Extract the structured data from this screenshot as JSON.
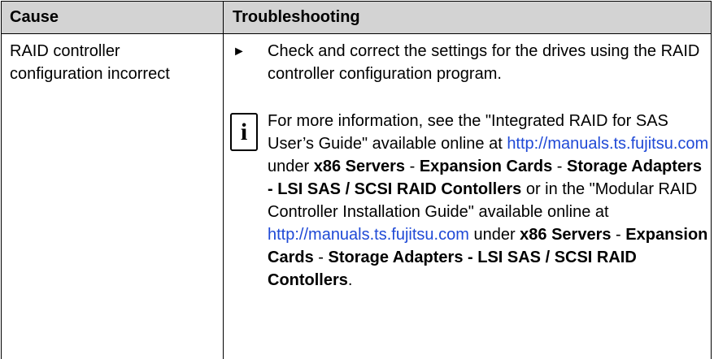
{
  "header": {
    "cause": "Cause",
    "troubleshooting": "Troubleshooting"
  },
  "row": {
    "cause_line1": "RAID controller",
    "cause_line2": "configuration incorrect",
    "bullet": "►",
    "step": "Check and correct the settings for the drives using the RAID controller configuration program."
  },
  "info_icon": "info-icon",
  "note": {
    "intro": "For more information, see the \"Integrated RAID for SAS User’s Guide\" available online at ",
    "link1": "http://manuals.ts.fujitsu.com",
    "under1": " under ",
    "x86_1": "x86 Servers",
    "sep1a": " - ",
    "exp1": "Expansion Cards",
    "sep1b": " - ",
    "storage1": "Storage Adapters - LSI SAS / SCSI RAID Contollers",
    "mid": " or in the \"Modular RAID Controller Installation Guide\" available online at ",
    "link2": "http://manuals.ts.fujitsu.com",
    "under2": " under ",
    "x86_2": "x86 Servers",
    "sep2a": " - ",
    "exp2": "Expansion Cards",
    "sep2b": " - ",
    "storage2": "Storage Adapters - LSI SAS / SCSI RAID Contollers",
    "end": "."
  },
  "colors": {
    "header_bg": "#d3d3d3",
    "link": "#1f49d6"
  }
}
